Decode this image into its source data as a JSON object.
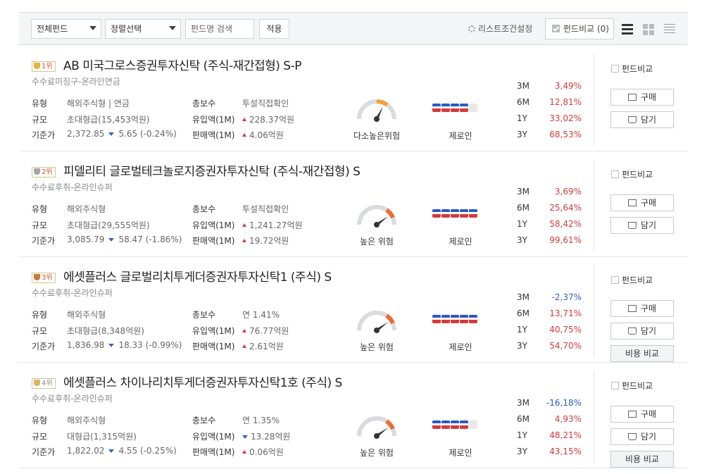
{
  "toolbar": {
    "fund_type": "전체펀드",
    "sort": "정렬선택",
    "search_placeholder": "펀드명 검색",
    "apply": "적용",
    "list_condition": "리스트조건설정",
    "compare": "펀드비교 (0)"
  },
  "labels": {
    "type": "유형",
    "size": "규모",
    "base_price": "기준가",
    "fee": "총보수",
    "inflow": "유입액(1M)",
    "sales": "판매액(1M)",
    "compare": "펀드비교",
    "buy": "구매",
    "cart": "담기",
    "cost_compare": "비용 비교"
  },
  "funds": [
    {
      "rank": "1위",
      "name": "AB 미국그로스증권투자신탁 (주식-재간접형) S-P",
      "sub": "수수료미징구-온라인연금",
      "type": "해외주식형 | 연금",
      "size": "초대형급(15,453억원)",
      "base": "2,372.85",
      "change": "5.65",
      "change_pct": "(-0.24%)",
      "fee": "투설직접확인",
      "inflow": "228.37억원",
      "inflow_dir": "up",
      "sales": "4.06억원",
      "sales_dir": "up",
      "risk": "다소높은위험",
      "risk_level": 0.65,
      "manager": "제로인",
      "manager_rating": 4,
      "returns": [
        {
          "period": "3M",
          "value": "3,49%",
          "sign": "pos"
        },
        {
          "period": "6M",
          "value": "12,81%",
          "sign": "pos"
        },
        {
          "period": "1Y",
          "value": "33,02%",
          "sign": "pos"
        },
        {
          "period": "3Y",
          "value": "68,53%",
          "sign": "pos"
        }
      ]
    },
    {
      "rank": "2위",
      "name": "피델리티 글로벌테크놀로지증권자투자신탁 (주식-재간접형) S",
      "sub": "수수료후취-온라인슈퍼",
      "type": "해외주식형",
      "size": "초대형급(29,555억원)",
      "base": "3,085.79",
      "change": "58.47",
      "change_pct": "(-1.86%)",
      "fee": "투설직접확인",
      "inflow": "1,241.27억원",
      "inflow_dir": "up",
      "sales": "19.72억원",
      "sales_dir": "up",
      "risk": "높은 위험",
      "risk_level": 0.8,
      "manager": "제로인",
      "manager_rating": 5,
      "returns": [
        {
          "period": "3M",
          "value": "3,69%",
          "sign": "pos"
        },
        {
          "period": "6M",
          "value": "25,64%",
          "sign": "pos"
        },
        {
          "period": "1Y",
          "value": "58,42%",
          "sign": "pos"
        },
        {
          "period": "3Y",
          "value": "99,61%",
          "sign": "pos"
        }
      ]
    },
    {
      "rank": "3위",
      "name": "에셋플러스 글로벌리치투게더증권자투자신탁1 (주식) S",
      "sub": "수수료후취-온라인슈퍼",
      "type": "해외주식형",
      "size": "초대형급(8,348억원)",
      "base": "1,836.98",
      "change": "18.33",
      "change_pct": "(-0.99%)",
      "fee": "연 1.41%",
      "inflow": "76.77억원",
      "inflow_dir": "up",
      "sales": "2.61억원",
      "sales_dir": "up",
      "risk": "높은 위험",
      "risk_level": 0.8,
      "manager": "제로인",
      "manager_rating": 5,
      "returns": [
        {
          "period": "3M",
          "value": "-2,37%",
          "sign": "neg"
        },
        {
          "period": "6M",
          "value": "13,71%",
          "sign": "pos"
        },
        {
          "period": "1Y",
          "value": "40,75%",
          "sign": "pos"
        },
        {
          "period": "3Y",
          "value": "54,70%",
          "sign": "pos"
        }
      ]
    },
    {
      "rank": "4위",
      "name": "에셋플러스 차이나리치투게더증권자투자신탁1호 (주식) S",
      "sub": "수수료후취-온라인슈퍼",
      "type": "해외주식형",
      "size": "대형급(1,315억원)",
      "base": "1,822.02",
      "change": "4.55",
      "change_pct": "(-0.25%)",
      "fee": "연 1.35%",
      "inflow": "13.28억원",
      "inflow_dir": "down",
      "sales": "0.06억원",
      "sales_dir": "up",
      "risk": "높은 위험",
      "risk_level": 0.8,
      "manager": "제로인",
      "manager_rating": 4,
      "returns": [
        {
          "period": "3M",
          "value": "-16,18%",
          "sign": "neg"
        },
        {
          "period": "6M",
          "value": "4,93%",
          "sign": "pos"
        },
        {
          "period": "1Y",
          "value": "48,21%",
          "sign": "pos"
        },
        {
          "period": "3Y",
          "value": "43,15%",
          "sign": "pos"
        }
      ]
    }
  ]
}
